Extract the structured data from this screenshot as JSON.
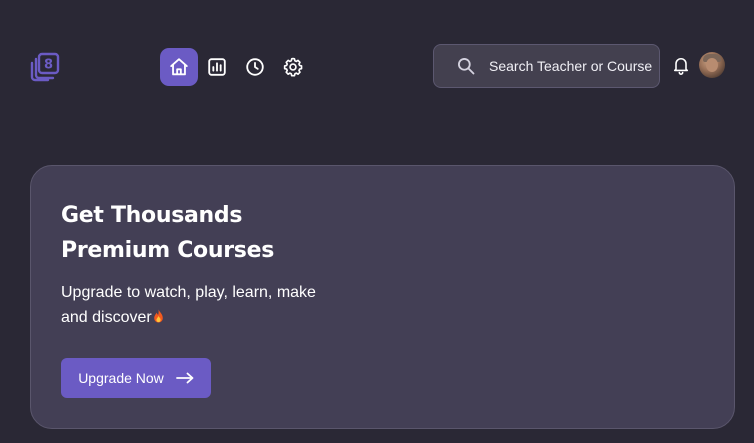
{
  "header": {
    "logo_icon": "book-stack-logo-icon",
    "nav": [
      {
        "icon": "home-icon",
        "active": true
      },
      {
        "icon": "chart-icon",
        "active": false
      },
      {
        "icon": "clock-icon",
        "active": false
      },
      {
        "icon": "gear-icon",
        "active": false
      }
    ],
    "search": {
      "icon": "search-icon",
      "placeholder": "Search Teacher or Course"
    },
    "notification_icon": "bell-icon",
    "avatar_icon": "user-avatar"
  },
  "hero": {
    "title_line1": "Get Thousands",
    "title_line2": "Premium Courses",
    "subtitle_line1": "Upgrade to watch, play, learn, make",
    "subtitle_line2": "and discover",
    "subtitle_emoji_icon": "fire-icon",
    "button_label": "Upgrade Now",
    "button_icon": "arrow-right-icon"
  },
  "colors": {
    "background": "#2a2835",
    "card": "#433f55",
    "accent": "#6b5bc4",
    "search_bg": "#43404f",
    "text": "#ffffff"
  }
}
